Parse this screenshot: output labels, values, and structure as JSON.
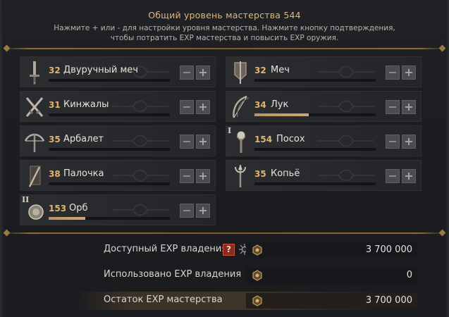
{
  "header": {
    "title": "Общий уровень мастерства 544",
    "subtitle_line1": "Нажмите + или - для настройки уровня мастерства. Нажмите кнопку подтверждения,",
    "subtitle_line2": "чтобы потратить EXP мастерства и повысить EXP оружия."
  },
  "buttons": {
    "minus": "−",
    "plus": "+"
  },
  "weapons": [
    {
      "level": "32",
      "name": "Двуручный меч",
      "progress": 0,
      "icon": "greatsword-icon"
    },
    {
      "level": "32",
      "name": "Меч",
      "progress": 0,
      "icon": "sword-icon"
    },
    {
      "level": "31",
      "name": "Кинжалы",
      "progress": 0,
      "icon": "daggers-icon"
    },
    {
      "level": "34",
      "name": "Лук",
      "progress": 0.45,
      "icon": "bow-icon"
    },
    {
      "level": "35",
      "name": "Арбалет",
      "progress": 0,
      "icon": "crossbow-icon"
    },
    {
      "level": "154",
      "name": "Посох",
      "progress": 0,
      "icon": "staff-icon",
      "tier": "I"
    },
    {
      "level": "38",
      "name": "Палочка",
      "progress": 0,
      "icon": "wand-icon"
    },
    {
      "level": "35",
      "name": "Копьё",
      "progress": 0,
      "icon": "spear-icon"
    },
    {
      "level": "153",
      "name": "Орб",
      "progress": 0.3,
      "icon": "orb-icon",
      "tier": "II"
    }
  ],
  "summary": {
    "available_label": "Доступный EXP владения",
    "available_value": "3 700 000",
    "help_label": "?",
    "used_label": "Использовано EXP владения",
    "used_value": "0",
    "remaining_label": "Остаток EXP мастерства",
    "remaining_value": "3 700 000"
  },
  "colors": {
    "accent": "#e1b77a",
    "level": "#e1b470",
    "highlight_row": "#3d3228"
  }
}
